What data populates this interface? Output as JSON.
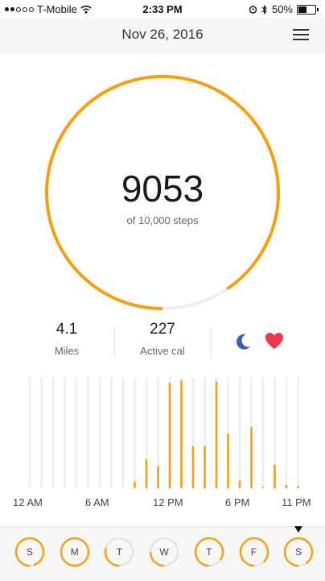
{
  "status": {
    "carrier": "T-Mobile",
    "time": "2:33 PM",
    "battery": "50%",
    "battery_level": 0.5,
    "icons": [
      "signal-icon",
      "wifi-icon",
      "alarm-icon",
      "bluetooth-icon",
      "battery-icon"
    ]
  },
  "header": {
    "date": "Nov 26, 2016",
    "menu_icon": "hamburger-icon"
  },
  "progress": {
    "steps": "9053",
    "goal_text": "of 10,000 steps",
    "fraction": 0.9053,
    "color": "#f5a011",
    "track_color": "#eceef0"
  },
  "stats": [
    {
      "value": "4.1",
      "label": "Miles"
    },
    {
      "value": "227",
      "label": "Active cal"
    }
  ],
  "icons": {
    "sleep": "moon-icon",
    "heart": "heart-icon",
    "sleep_color": "#3f5db3",
    "heart_color": "#f0364f"
  },
  "chart_data": {
    "type": "bar",
    "xlabel": "",
    "ylabel": "",
    "x_tick_labels": [
      "12 AM",
      "6 AM",
      "12 PM",
      "6 PM",
      "11 PM"
    ],
    "hours": [
      0,
      1,
      2,
      3,
      4,
      5,
      6,
      7,
      8,
      9,
      10,
      11,
      12,
      13,
      14,
      15,
      16,
      17,
      18,
      19,
      20,
      21,
      22,
      23
    ],
    "values": [
      0,
      0,
      0,
      0,
      0,
      0,
      0,
      0,
      0,
      0.06,
      0.26,
      0.2,
      0.95,
      0.97,
      0.38,
      0.38,
      0.96,
      0.49,
      0.07,
      0.55,
      0.01,
      0.21,
      0.03,
      0.02
    ],
    "ylim": [
      0,
      1
    ],
    "bar_color": "#f5a011",
    "background_bar_color": "#eef0f2"
  },
  "week": {
    "days": [
      {
        "label": "S",
        "fraction": 0.95
      },
      {
        "label": "M",
        "fraction": 1.0
      },
      {
        "label": "T",
        "fraction": 0.3
      },
      {
        "label": "W",
        "fraction": 0.25
      },
      {
        "label": "T",
        "fraction": 0.85
      },
      {
        "label": "F",
        "fraction": 0.88
      },
      {
        "label": "S",
        "fraction": 0.9
      }
    ],
    "selected_index": 6
  }
}
